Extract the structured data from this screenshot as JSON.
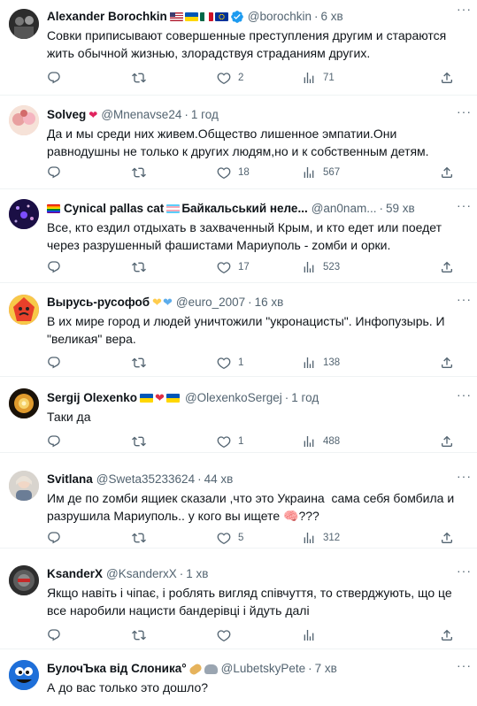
{
  "tweets": [
    {
      "name": "Alexander Borochkin",
      "badges": [
        "flag-us",
        "flag-ua",
        "flag-mx",
        "flag-eu",
        "verified"
      ],
      "handle": "@borochkin",
      "time": "6 хв",
      "text": "Совки приписывают совершенные преступления другим и стараются жить обычной жизнью, злорадствуя страданиям других.",
      "replies": "",
      "retweets": "",
      "likes": "2",
      "views": "71",
      "avatar_color": "#3a3a3a"
    },
    {
      "name": "Solveg",
      "badges": [
        "heart-emoji"
      ],
      "handle": "@Mnenavse24",
      "time": "1 год",
      "text": "Да и мы среди них живем.Общество лишенное эмпатии.Они равнодушны не только к других людям,но и к собственным детям.",
      "replies": "",
      "retweets": "",
      "likes": "18",
      "views": "567",
      "avatar_color": "#f2c6b6"
    },
    {
      "name": "Cynical pallas cat",
      "name_suffix": "Байкальський неле...",
      "badges": [
        "rainbow-flag",
        "trans-flag"
      ],
      "handle": "@an0nam...",
      "time": "59 хв",
      "text": "Все, кто ездил отдыхать в захваченный Крым, и кто едет или поедет через разрушенный фашистами Мариуполь - zомби и орки.",
      "replies": "",
      "retweets": "",
      "likes": "17",
      "views": "523",
      "avatar_color": "#2a1a5e"
    },
    {
      "name": "Вырусь-русофоб",
      "badges": [
        "yellow-heart",
        "blue-heart"
      ],
      "handle": "@euro_2007",
      "time": "16 хв",
      "text": "В их мире город и людей уничтожили \"укронацисты\". Инфопузырь. И \"великая\" вера.",
      "replies": "",
      "retweets": "",
      "likes": "1",
      "views": "138",
      "avatar_color": "#e8402a"
    },
    {
      "name": "Sergij Olexenko",
      "badges": [
        "flag-ua",
        "red-heart",
        "flag-ua"
      ],
      "handle": "@OlexenkoSergej",
      "time": "1 год",
      "text": "Таки да",
      "replies": "",
      "retweets": "",
      "likes": "1",
      "views": "488",
      "avatar_color": "#2b1d0e"
    },
    {
      "name": "Svitlana",
      "badges": [],
      "handle": "@Sweta35233624",
      "time": "44 хв",
      "text": "Им де по zомби ящиек сказали ,что это Украина  сама себя бомбила и разрушила Мариуполь.. у кого вы ищете 🧠???",
      "replies": "",
      "retweets": "",
      "likes": "5",
      "views": "312",
      "avatar_color": "#c9c4bd"
    },
    {
      "name": "KsanderX",
      "badges": [],
      "handle": "@KsanderxX",
      "time": "1 хв",
      "text": "Якщо навіть і чіпає, і роблять вигляд співчуття, то стверджують, що це все наробили нацисти бандерівці і йдуть далі",
      "replies": "",
      "retweets": "",
      "likes": "",
      "views": "",
      "avatar_color": "#4a4a4a"
    },
    {
      "name": "БулочЪка від Слоника",
      "name_suffix": "°",
      "badges": [
        "bread-emoji",
        "elephant-emoji"
      ],
      "handle": "@LubetskyPete",
      "time": "7 хв",
      "text": "А до вас только это дошло?",
      "replies": "",
      "retweets": "",
      "likes": "",
      "views": "",
      "avatar_color": "#1a5fb4"
    }
  ]
}
